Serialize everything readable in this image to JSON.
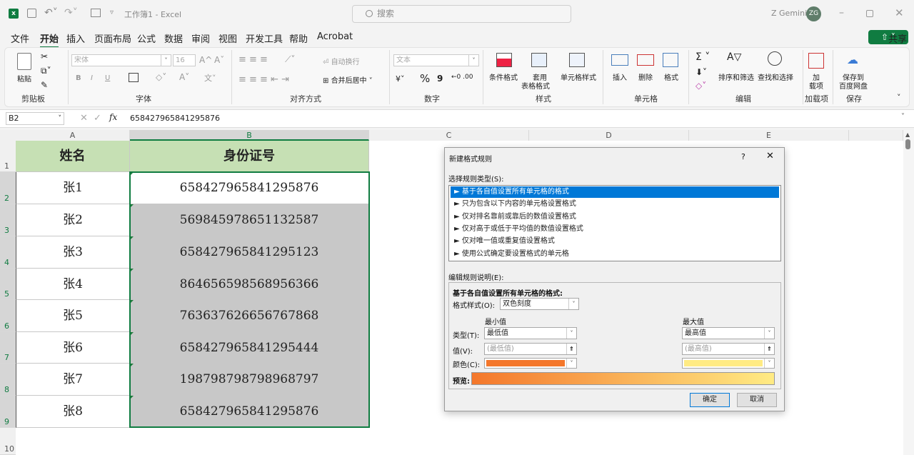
{
  "titlebar": {
    "doc_title": "工作簿1 - Excel",
    "search_placeholder": "搜索",
    "user": "Z Gemini",
    "avatar": "ZG",
    "share": "共享"
  },
  "menu": [
    "文件",
    "开始",
    "插入",
    "页面布局",
    "公式",
    "数据",
    "审阅",
    "视图",
    "开发工具",
    "帮助",
    "Acrobat"
  ],
  "ribbon": {
    "paste": "粘贴",
    "font_name": "宋体",
    "font_size": "16",
    "bold": "B",
    "italic": "I",
    "underline": "U",
    "grow": "A^",
    "shrink": "Aˇ",
    "wrap": "自动换行",
    "merge": "合并后居中",
    "numfmt": "文本",
    "percent": "%",
    "comma": "9",
    "cond": "条件格式",
    "table1": "套用",
    "table2": "表格格式",
    "cellstyle": "单元格样式",
    "insert": "插入",
    "delete": "删除",
    "format": "格式",
    "sortfilter": "排序和筛选",
    "findselect": "查找和选择",
    "addin1": "加",
    "addin2": "载项",
    "save1": "保存到",
    "save2": "百度网盘",
    "groups": [
      "剪贴板",
      "字体",
      "对齐方式",
      "数字",
      "样式",
      "单元格",
      "编辑",
      "加载项",
      "保存"
    ]
  },
  "formula": {
    "namebox": "B2",
    "fx": "fx",
    "value": "658427965841295876"
  },
  "columns": [
    "A",
    "B",
    "C",
    "D",
    "E"
  ],
  "rows": [
    "1",
    "2",
    "3",
    "4",
    "5",
    "6",
    "7",
    "8",
    "9",
    "10"
  ],
  "table": {
    "header": [
      "姓名",
      "身份证号"
    ],
    "data": [
      [
        "张1",
        "658427965841295876"
      ],
      [
        "张2",
        "569845978651132587"
      ],
      [
        "张3",
        "658427965841295123"
      ],
      [
        "张4",
        "864656598568956366"
      ],
      [
        "张5",
        "763637626656767868"
      ],
      [
        "张6",
        "658427965841295444"
      ],
      [
        "张7",
        "198798798798968797"
      ],
      [
        "张8",
        "658427965841295876"
      ]
    ]
  },
  "dialog": {
    "title": "新建格式规则",
    "help": "?",
    "close": "✕",
    "select_label": "选择规则类型(S):",
    "rules": [
      "► 基于各自值设置所有单元格的格式",
      "► 只为包含以下内容的单元格设置格式",
      "► 仅对排名靠前或靠后的数值设置格式",
      "► 仅对高于或低于平均值的数值设置格式",
      "► 仅对唯一值或重复值设置格式",
      "► 使用公式确定要设置格式的单元格"
    ],
    "edit_label": "编辑规则说明(E):",
    "desc_title": "基于各自值设置所有单元格的格式:",
    "style_label": "格式样式(O):",
    "style_value": "双色刻度",
    "min_label": "最小值",
    "max_label": "最大值",
    "type_label": "类型(T):",
    "type_min": "最低值",
    "type_max": "最高值",
    "value_label": "值(V):",
    "value_min_ph": "(最低值)",
    "value_max_ph": "(最高值)",
    "color_label": "颜色(C):",
    "preview_label": "预览:",
    "ok": "确定",
    "cancel": "取消",
    "min_color": "#f4772b",
    "max_color": "#ffeb84"
  }
}
